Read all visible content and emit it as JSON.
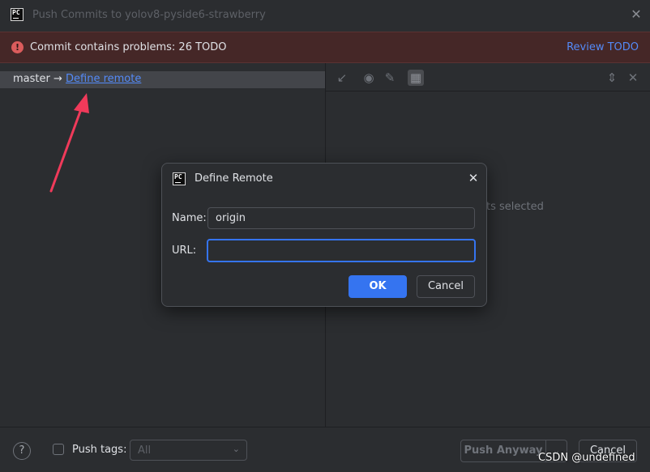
{
  "window": {
    "title": "Push Commits to yolov8-pyside6-strawberry",
    "logo_text": "PC",
    "close_glyph": "✕"
  },
  "banner": {
    "icon_glyph": "!",
    "message": "Commit contains problems: 26 TODO",
    "link": "Review TODO",
    "color_error": "#db5c5c"
  },
  "branch_row": {
    "source": "master →",
    "link": "Define remote"
  },
  "toolbar": {
    "icons": [
      "collapse-icon",
      "eye-icon",
      "edit-icon",
      "grid-icon",
      "expand-collapse-icon",
      "close-icon"
    ],
    "glyph_collapse": "↙",
    "glyph_eye": "◉",
    "glyph_edit": "✎",
    "glyph_grid": "▦",
    "glyph_updown": "⇕",
    "glyph_close": "✕"
  },
  "right_pane": {
    "empty_text": "ts selected"
  },
  "bottom": {
    "help_glyph": "?",
    "push_tags_label": "Push tags:",
    "tags_value": "All",
    "chevron_glyph": "⌄",
    "push_anyway": "Push Anyway",
    "cancel": "Cancel",
    "watermark": "CSDN @undefined"
  },
  "dialog": {
    "title": "Define Remote",
    "close_glyph": "✕",
    "name_label": "Name:",
    "name_value": "origin",
    "url_label": "URL:",
    "url_value": "",
    "ok": "OK",
    "cancel": "Cancel",
    "accent": "#3574f0"
  }
}
